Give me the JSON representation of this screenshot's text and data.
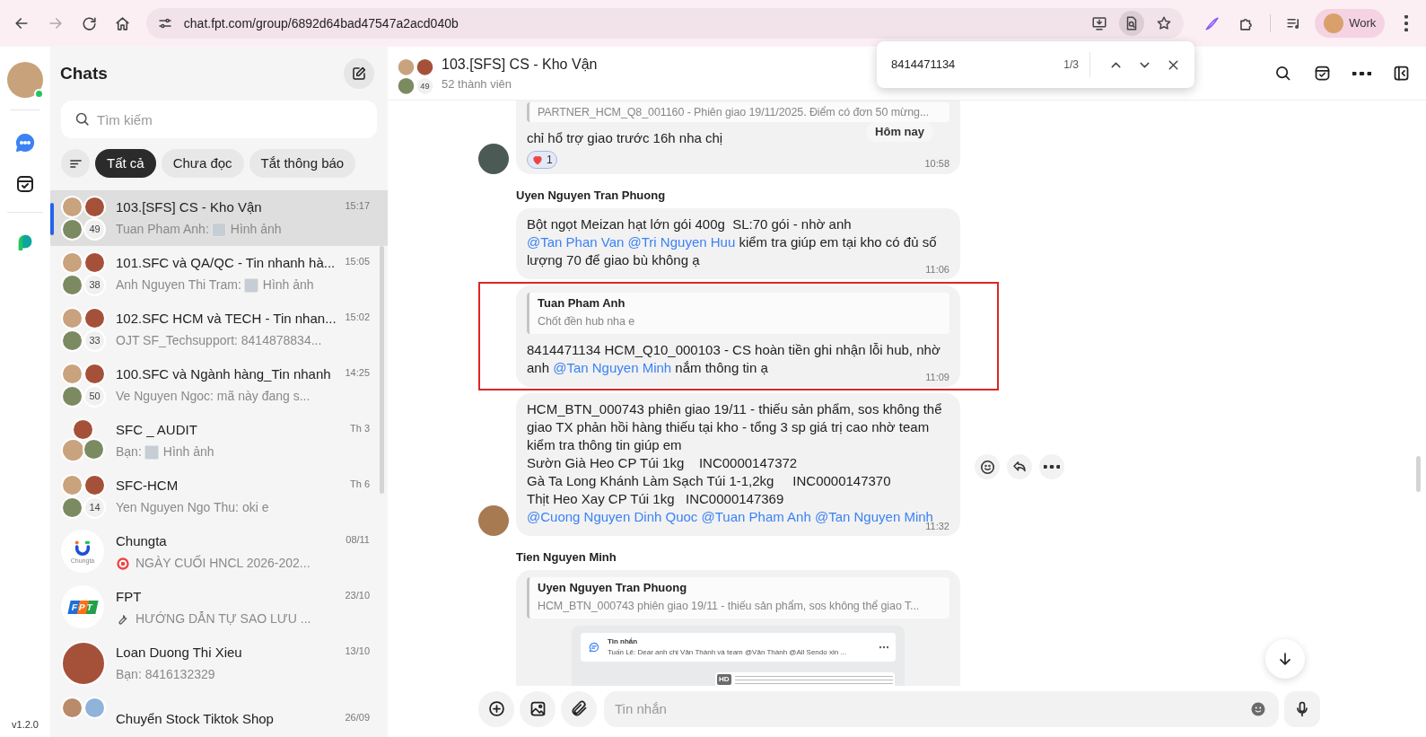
{
  "browser": {
    "url": "chat.fpt.com/group/6892d64bad47547a2acd040b",
    "profile_label": "Work",
    "find_active": true
  },
  "find_bar": {
    "query": "8414471134",
    "count": "1/3"
  },
  "rail": {
    "online": true,
    "version": "v1.2.0"
  },
  "sidebar": {
    "title": "Chats",
    "search": {
      "placeholder": "Tìm kiếm"
    },
    "filters": [
      {
        "label": "Tất cả",
        "selected": true
      },
      {
        "label": "Chưa đọc",
        "selected": false
      },
      {
        "label": "Tắt thông báo",
        "selected": false
      }
    ],
    "chats": [
      {
        "name": "103.[SFS] CS - Kho Vận",
        "time": "15:17",
        "avatar": {
          "kind": "group",
          "count": "49"
        },
        "preview": {
          "kind": "image",
          "sender": "Tuan Pham Anh:",
          "text": "Hình ảnh"
        },
        "selected": true
      },
      {
        "name": "101.SFC và QA/QC - Tin nhanh hà...",
        "time": "15:05",
        "avatar": {
          "kind": "group",
          "count": "38"
        },
        "preview": {
          "kind": "image",
          "sender": "Anh Nguyen Thi Tram:",
          "text": "Hình ảnh"
        },
        "selected": false
      },
      {
        "name": "102.SFC HCM và TECH - Tin nhan...",
        "time": "15:02",
        "avatar": {
          "kind": "group",
          "count": "33"
        },
        "preview": {
          "kind": "text",
          "text": "OJT SF_Techsupport: 8414878834..."
        },
        "selected": false
      },
      {
        "name": "100.SFC và Ngành hàng_Tin nhanh",
        "time": "14:25",
        "avatar": {
          "kind": "group",
          "count": "50"
        },
        "preview": {
          "kind": "text",
          "text": "Ve Nguyen Ngoc: mã này đang s..."
        },
        "selected": false
      },
      {
        "name": "SFC _ AUDIT",
        "time": "Th 3",
        "avatar": {
          "kind": "trio"
        },
        "preview": {
          "kind": "image",
          "sender": "Bạn:",
          "text": "Hình ảnh"
        },
        "selected": false
      },
      {
        "name": "SFC-HCM",
        "time": "Th 6",
        "avatar": {
          "kind": "group",
          "count": "14"
        },
        "preview": {
          "kind": "text",
          "text": "Yen Nguyen Ngo Thu: oki e"
        },
        "selected": false
      },
      {
        "name": "Chungta",
        "time": "08/11",
        "avatar": {
          "kind": "logo-u",
          "logo_text": "Chungta"
        },
        "preview": {
          "kind": "target",
          "text": "NGÀY CUỐI HNCL 2026-202..."
        },
        "selected": false
      },
      {
        "name": "FPT",
        "time": "23/10",
        "avatar": {
          "kind": "logo-tiles",
          "logo_text": "FPT"
        },
        "preview": {
          "kind": "wrench",
          "text": "HƯỚNG DẪN TỰ SAO LƯU ..."
        },
        "selected": false
      },
      {
        "name": "Loan Duong Thi Xieu",
        "time": "13/10",
        "avatar": {
          "kind": "single"
        },
        "preview": {
          "kind": "text",
          "text": "Bạn: 8416132329"
        },
        "selected": false
      },
      {
        "name": "Chuyển Stock Tiktok Shop",
        "time": "26/09",
        "avatar": {
          "kind": "pair"
        },
        "selected": false
      }
    ]
  },
  "chat": {
    "title": "103.[SFS] CS - Kho Vận",
    "members": "52 thành viên",
    "member_count": "49",
    "date_pill": "Hôm nay",
    "messages": [
      {
        "avatar": true,
        "quote": {
          "text": "PARTNER_HCM_Q8_001160 - Phiên giao 19/11/2025. Điểm có đơn 50 mừng..."
        },
        "paragraphs": [
          [
            {
              "kind": "text",
              "t": "chỉ hổ trợ giao trước 16h nha chị"
            }
          ]
        ],
        "reaction": "1",
        "time": "10:58",
        "highlighted": false,
        "actions": false
      },
      {
        "sender": "Uyen Nguyen Tran Phuong",
        "avatar": false,
        "paragraphs": [
          [
            {
              "kind": "text",
              "t": "Bột ngọt Meizan hạt lớn gói 400g  SL:70 gói - nhờ anh"
            },
            {
              "kind": "mention",
              "t": "@Tan Phan Van"
            },
            {
              "kind": "mention",
              "t": "@Tri Nguyen Huu"
            },
            {
              "kind": "text",
              "t": "kiểm tra giúp em tại kho có đủ số lượng 70 để giao bù không ạ"
            }
          ]
        ],
        "time": "11:06",
        "highlighted": false,
        "actions": false
      },
      {
        "avatar": false,
        "quote": {
          "author": "Tuan Pham Anh",
          "text": "Chốt đền hub nha e"
        },
        "paragraphs": [
          [
            {
              "kind": "text",
              "t": "8414471134 HCM_Q10_000103 - CS hoàn tiền ghi nhận lỗi hub, nhờ anh"
            },
            {
              "kind": "mention",
              "t": "@Tan Nguyen Minh"
            },
            {
              "kind": "text",
              "t": "nắm thông tin ạ"
            }
          ]
        ],
        "time": "11:09",
        "highlighted": true,
        "actions": false
      },
      {
        "avatar": true,
        "paragraphs": [
          [
            {
              "kind": "text",
              "t": "HCM_BTN_000743 phiên giao 19/11 - thiếu sản phẩm, sos không thể giao TX phản hồi hàng thiếu tại kho - tổng 3 sp giá trị cao nhờ team kiểm tra thông tin giúp em"
            }
          ],
          [
            {
              "kind": "text",
              "t": "Sườn Già Heo CP Túi 1kg    INC0000147372"
            }
          ],
          [
            {
              "kind": "text",
              "t": "Gà Ta Long Khánh Làm Sạch Túi 1-1,2kg     INC0000147370"
            }
          ],
          [
            {
              "kind": "text",
              "t": "Thịt Heo Xay CP Túi 1kg   INC0000147369"
            }
          ],
          [
            {
              "kind": "mention",
              "t": "@Cuong Nguyen Dinh Quoc"
            },
            {
              "kind": "mention",
              "t": "@Tuan Pham Anh"
            },
            {
              "kind": "mention",
              "t": "@Tan Nguyen Minh"
            }
          ]
        ],
        "time": "11:32",
        "highlighted": false,
        "actions": true
      },
      {
        "sender": "Tien Nguyen Minh",
        "avatar": false,
        "quote": {
          "author": "Uyen Nguyen Tran Phuong",
          "text": "HCM_BTN_000743 phiên giao 19/11 - thiếu sản phẩm, sos không thể giao T..."
        },
        "attachment": {
          "title": "Tin nhắn",
          "text": "Tuấn Lê: Dear anh chị Văn Thành và team @Văn Thành @All  Sendo xin ...",
          "badge": "HD"
        },
        "highlighted": false,
        "actions": false
      }
    ],
    "composer": {
      "placeholder": "Tin nhắn"
    }
  }
}
